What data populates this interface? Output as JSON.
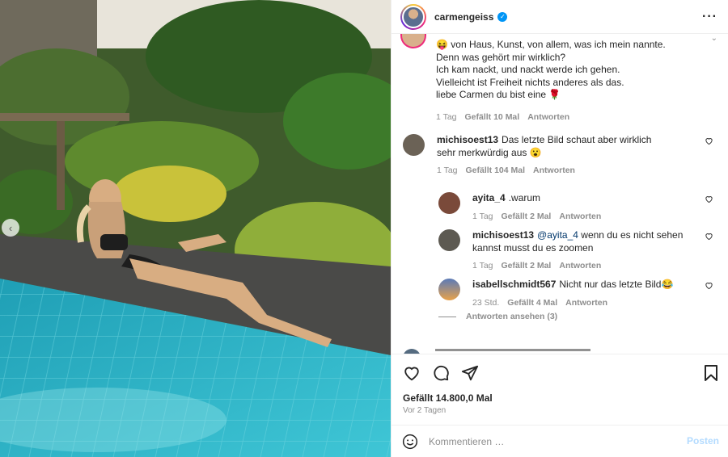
{
  "post": {
    "username": "carmengeiss",
    "verified_mark": "✓",
    "more_icon": "more-horizontal-icon"
  },
  "caption": {
    "lines": [
      "von Haus, Kunst, von allem, was ich mein nannte.",
      "Denn was gehört mir wirklich?",
      "Ich kam nackt, und nackt werde ich gehen.",
      "Vielleicht ist Freiheit nichts anderes als das.",
      "liebe Carmen du bist eine 🌹"
    ],
    "lead_emoji": "😝",
    "time": "1 Tag",
    "likes": "Gefällt 10 Mal",
    "reply": "Antworten"
  },
  "comments": [
    {
      "user": "michisoest13",
      "mention": "",
      "text": "Das letzte Bild schaut aber wirklich sehr merkwürdig aus 😮",
      "time": "1 Tag",
      "likes": "Gefällt 104 Mal",
      "reply": "Antworten"
    },
    {
      "user": "ayita_4",
      "mention": "",
      "text": ".warum",
      "time": "1 Tag",
      "likes": "Gefällt 2 Mal",
      "reply": "Antworten"
    },
    {
      "user": "michisoest13",
      "mention": "@ayita_4",
      "text": "wenn du es nicht sehen kannst musst du es zoomen",
      "time": "1 Tag",
      "likes": "Gefällt 2 Mal",
      "reply": "Antworten"
    },
    {
      "user": "isabellschmidt567",
      "mention": "",
      "text": "Nicht nur das letzte Bild😂",
      "time": "23 Std.",
      "likes": "Gefällt 4 Mal",
      "reply": "Antworten"
    }
  ],
  "view_replies": "Antworten ansehen (3)",
  "footer": {
    "likes": "Gefällt 14.800,0 Mal",
    "ago": "Vor 2 Tagen"
  },
  "composer": {
    "placeholder": "Kommentieren …",
    "post_label": "Posten"
  },
  "colors": {
    "link": "#00376b",
    "muted": "#8e8e8e",
    "verified": "#0095f6",
    "post_button": "#b3dbff"
  }
}
